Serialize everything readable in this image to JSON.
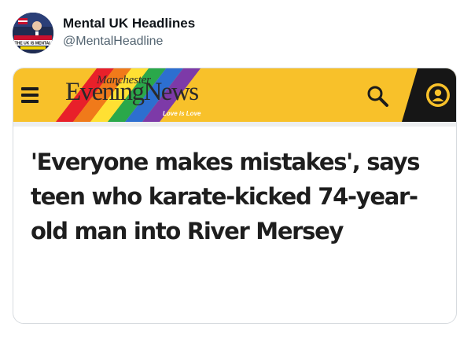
{
  "tweet": {
    "display_name": "Mental UK Headlines",
    "handle": "@MentalHeadline",
    "avatar": {
      "icon": "avatar-image",
      "caption": "THE UK IS MENTAL"
    }
  },
  "article": {
    "site_header": {
      "logo_top": "Manchester",
      "logo_main": "EveningNews",
      "tagline": "Love is Love",
      "background_color": "#f8c12a",
      "menu_icon": "hamburger-menu-icon",
      "search_icon": "search-icon",
      "account_icon": "user-account-icon"
    },
    "headline": "'Everyone makes mistakes', says teen who karate-kicked 74-year-old man into River Mersey"
  }
}
